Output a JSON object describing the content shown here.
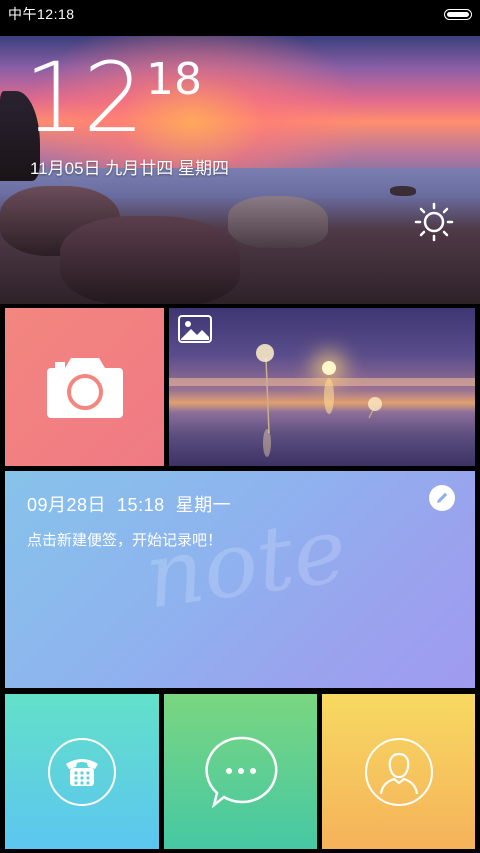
{
  "status_bar": {
    "time": "中午12:18",
    "battery_icon": "battery-full-icon"
  },
  "lock_banner": {
    "clock_hours": "12",
    "clock_minutes": "18",
    "date_line": "11月05日  九月廿四  星期四",
    "weather_icon": "sun-icon"
  },
  "tiles": {
    "camera": {
      "icon": "camera-icon",
      "color": "#f3867f"
    },
    "gallery": {
      "icon": "image-icon"
    },
    "note": {
      "datetime": "09月28日  15:18  星期一",
      "hint": "点击新建便签，开始记录吧！",
      "watermark": "note",
      "edit_icon": "pencil-icon"
    },
    "phone": {
      "icon": "phone-keypad-icon"
    },
    "messages": {
      "icon": "chat-bubble-icon"
    },
    "contacts": {
      "icon": "contact-person-icon"
    }
  }
}
